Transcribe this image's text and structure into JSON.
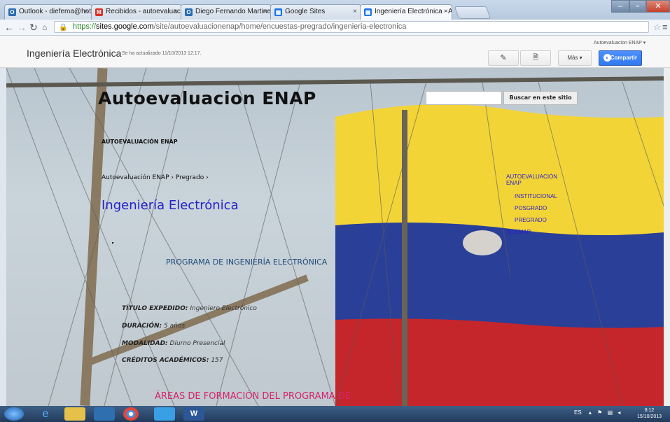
{
  "browser": {
    "tabs": [
      {
        "label": "Outlook - diefema@hotm",
        "icon": "outlook-icon",
        "color": "#2b6cb0"
      },
      {
        "label": "Recibidos - autoevaluacio",
        "icon": "gmail-icon",
        "color": "#d93025"
      },
      {
        "label": "Diego Fernando Martinez",
        "icon": "outlook-icon",
        "color": "#2b6cb0"
      },
      {
        "label": "Google Sites",
        "icon": "sites-icon",
        "color": "#1a73e8"
      },
      {
        "label": "Ingeniería Electrónica - A",
        "icon": "sites-icon",
        "color": "#1a73e8"
      }
    ],
    "url": {
      "scheme": "https://",
      "host": "sites.google.com",
      "path": "/site/autoevaluacionenap/home/encuestas-pregrado/ingenieria-electronica"
    }
  },
  "siteheader": {
    "site_name": "Ingeniería Electrónica",
    "updated": "Se ha actualizado 11/10/2013 12:17.",
    "more_label": "Más ▾",
    "share_label": "Compartir",
    "account": "Autoevaluacion ENAP ▾"
  },
  "page": {
    "site_title": "Autoevaluacion ENAP",
    "search_button": "Buscar en este sitio",
    "horizontal_nav": "AUTOEVALUACIÓN ENAP",
    "breadcrumb": "Autoevaluación ENAP › Pregrado ›",
    "page_title": "Ingeniería Electrónica",
    "sidebar": {
      "heading_line1": "AUTOEVALUACIÓN",
      "heading_line2": "ENAP",
      "items": [
        "INSTITUCIONAL",
        "POSGRADO",
        "PREGRADO"
      ],
      "sitemap": "SITEMAP"
    },
    "program_title": "PROGRAMA DE INGENIERÍA ELECTRÓNICA",
    "info": [
      {
        "label": "TÍTULO EXPEDIDO:",
        "value": "Ingeniero Electrónico"
      },
      {
        "label": "DURACIÓN:",
        "value": "5 años"
      },
      {
        "label": "MODALIDAD:",
        "value": "Diurno Presencial"
      },
      {
        "label": "CRÉDITOS ACADÉMICOS:",
        "value": "157"
      }
    ],
    "areas_title": "ÁREAS DE FORMACIÓN DEL PROGRAMA DE"
  },
  "taskbar": {
    "lang": "ES",
    "time": "8:12",
    "date": "15/10/2013"
  }
}
